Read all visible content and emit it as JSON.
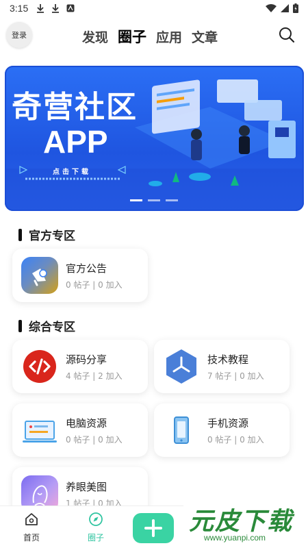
{
  "status_bar": {
    "time": "3:15"
  },
  "nav": {
    "login_label": "登录",
    "tabs": [
      {
        "label": "发现",
        "active": false
      },
      {
        "label": "圈子",
        "active": true
      },
      {
        "label": "应用",
        "active": false
      },
      {
        "label": "文章",
        "active": false
      }
    ]
  },
  "banner": {
    "title": "奇营社区",
    "app_text": "APP",
    "subtitle": "点击下载",
    "slides": 3,
    "active_slide": 1
  },
  "sections": [
    {
      "title": "官方专区",
      "cards": [
        {
          "name": "官方公告",
          "stats": "0 帖子 | 0 加入",
          "icon": "megaphone-icon"
        }
      ]
    },
    {
      "title": "综合专区",
      "cards": [
        {
          "name": "源码分享",
          "stats": "4 帖子 | 2 加入",
          "icon": "code-icon"
        },
        {
          "name": "技术教程",
          "stats": "7 帖子 | 0 加入",
          "icon": "hexagon-share-icon"
        },
        {
          "name": "电脑资源",
          "stats": "0 帖子 | 0 加入",
          "icon": "laptop-icon"
        },
        {
          "name": "手机资源",
          "stats": "0 帖子 | 0 加入",
          "icon": "phone-icon"
        },
        {
          "name": "养眼美图",
          "stats": "1 帖子 | 0 加入",
          "icon": "portrait-icon"
        }
      ]
    }
  ],
  "bottom_nav": {
    "items": [
      {
        "label": "首页",
        "icon": "home-icon",
        "active": false
      },
      {
        "label": "圈子",
        "icon": "compass-icon",
        "active": true
      }
    ],
    "fab_icon": "plus-icon"
  },
  "watermark": {
    "text": "元皮下载",
    "url": "www.yuanpi.com"
  },
  "colors": {
    "accent": "#3ad3a3",
    "banner_blue": "#2b6ff5"
  }
}
